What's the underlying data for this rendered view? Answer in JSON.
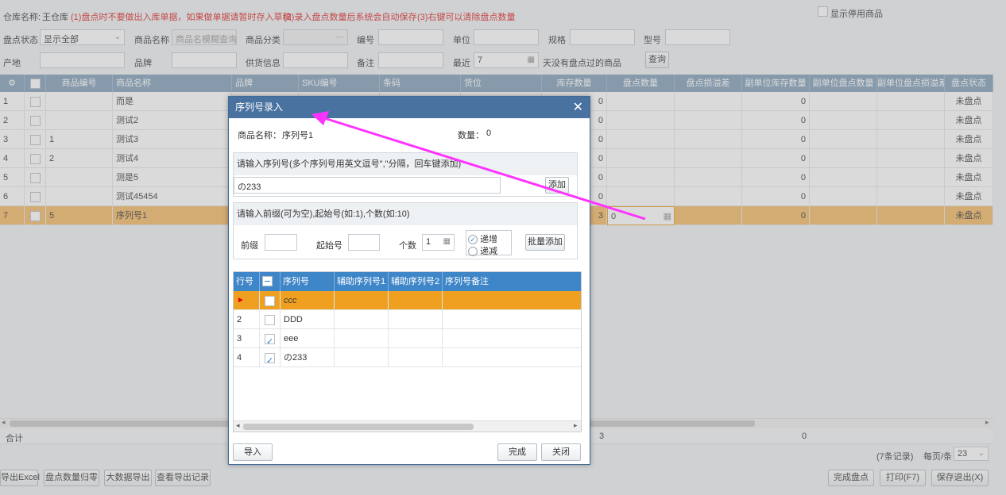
{
  "top": {
    "warehouse_label": "仓库名称:",
    "warehouse_value": "王仓库",
    "notice1": "(1)盘点时不要做出入库单据，如果做单据请暂时存入草稿",
    "notice2": "(2)录入盘点数量后系统会自动保存",
    "notice3": "(3)右键可以清除盘点数量",
    "show_disabled": "显示停用商品"
  },
  "filters": {
    "status_label": "盘点状态",
    "status_value": "显示全部",
    "name_label": "商品名称",
    "name_placeholder": "商品名模糊查询",
    "category_label": "商品分类",
    "code_label": "编号",
    "unit_label": "单位",
    "spec_label": "规格",
    "model_label": "型号",
    "origin_label": "产地",
    "brand_label": "品牌",
    "supplier_label": "供货信息",
    "remark_label": "备注",
    "recent_label": "最近",
    "recent_value": "7",
    "recent_suffix": "天没有盘点过的商品",
    "query_button": "查询"
  },
  "grid": {
    "columns": [
      "商品编号",
      "商品名称",
      "品牌",
      "SKU编号",
      "条码",
      "货位",
      "库存数量",
      "盘点数量",
      "盘点损溢差",
      "副单位库存数量",
      "副单位盘点数量",
      "副单位盘点损溢差",
      "盘点状态"
    ],
    "rows": [
      {
        "no": "1",
        "code": "",
        "name": "而是",
        "stock": "0",
        "count": "",
        "sub_stock": "0",
        "status": "未盘点"
      },
      {
        "no": "2",
        "code": "",
        "name": "测试2",
        "stock": "0",
        "count": "",
        "sub_stock": "0",
        "status": "未盘点"
      },
      {
        "no": "3",
        "code": "1",
        "name": "测试3",
        "stock": "0",
        "count": "",
        "sub_stock": "0",
        "status": "未盘点"
      },
      {
        "no": "4",
        "code": "2",
        "name": "测试4",
        "stock": "0",
        "count": "",
        "sub_stock": "0",
        "status": "未盘点"
      },
      {
        "no": "5",
        "code": "",
        "name": "测是5",
        "stock": "0",
        "count": "",
        "sub_stock": "0",
        "status": "未盘点"
      },
      {
        "no": "6",
        "code": "",
        "name": "测试45454",
        "stock": "0",
        "count": "",
        "sub_stock": "0",
        "status": "未盘点"
      },
      {
        "no": "7",
        "code": "5",
        "name": "序列号1",
        "stock": "3",
        "count": "0",
        "sub_stock": "0",
        "status": "未盘点"
      }
    ],
    "total_label": "合计",
    "total_stock": "3",
    "total_sub_stock": "0"
  },
  "pager": {
    "records": "(7条记录)",
    "per_page_label": "每页/条",
    "per_page_value": "23"
  },
  "footer": {
    "export_excel": "导出Excel",
    "reset_count": "盘点数量归零",
    "big_export": "大数据导出",
    "view_export": "查看导出记录",
    "finish_count": "完成盘点",
    "print": "打印(F7)",
    "save_exit": "保存退出(X)"
  },
  "modal": {
    "title": "序列号录入",
    "product_label": "商品名称：",
    "product_value": "序列号1",
    "qty_label": "数量：",
    "qty_value": "0",
    "serial_hint": "请输入序列号(多个序列号用英文逗号\",\"分隔，回车键添加)",
    "serial_input": "の233",
    "add_button": "添加",
    "batch_hint": "请输入前缀(可为空),起始号(如:1),个数(如:10)",
    "prefix_label": "前缀",
    "start_label": "起始号",
    "count_label": "个数",
    "count_value": "1",
    "inc_label": "递增",
    "dec_label": "递减",
    "batch_add_button": "批量添加",
    "columns": [
      "行号",
      "序列号",
      "辅助序列号1",
      "辅助序列号2",
      "序列号备注"
    ],
    "rows": [
      {
        "no": "",
        "serial": "ccc"
      },
      {
        "no": "2",
        "serial": "DDD"
      },
      {
        "no": "3",
        "serial": "eee"
      },
      {
        "no": "4",
        "serial": "の233"
      }
    ],
    "import_button": "导入",
    "finish_button": "完成",
    "close_button": "关闭"
  },
  "colors": {
    "header_blue": "#7f9db9",
    "modal_title": "#4a72a0",
    "selected_row": "#f5b962",
    "modal_selected_row": "#f0a020",
    "notice_red": "#e02020",
    "arrow_magenta": "#ff33ff"
  }
}
